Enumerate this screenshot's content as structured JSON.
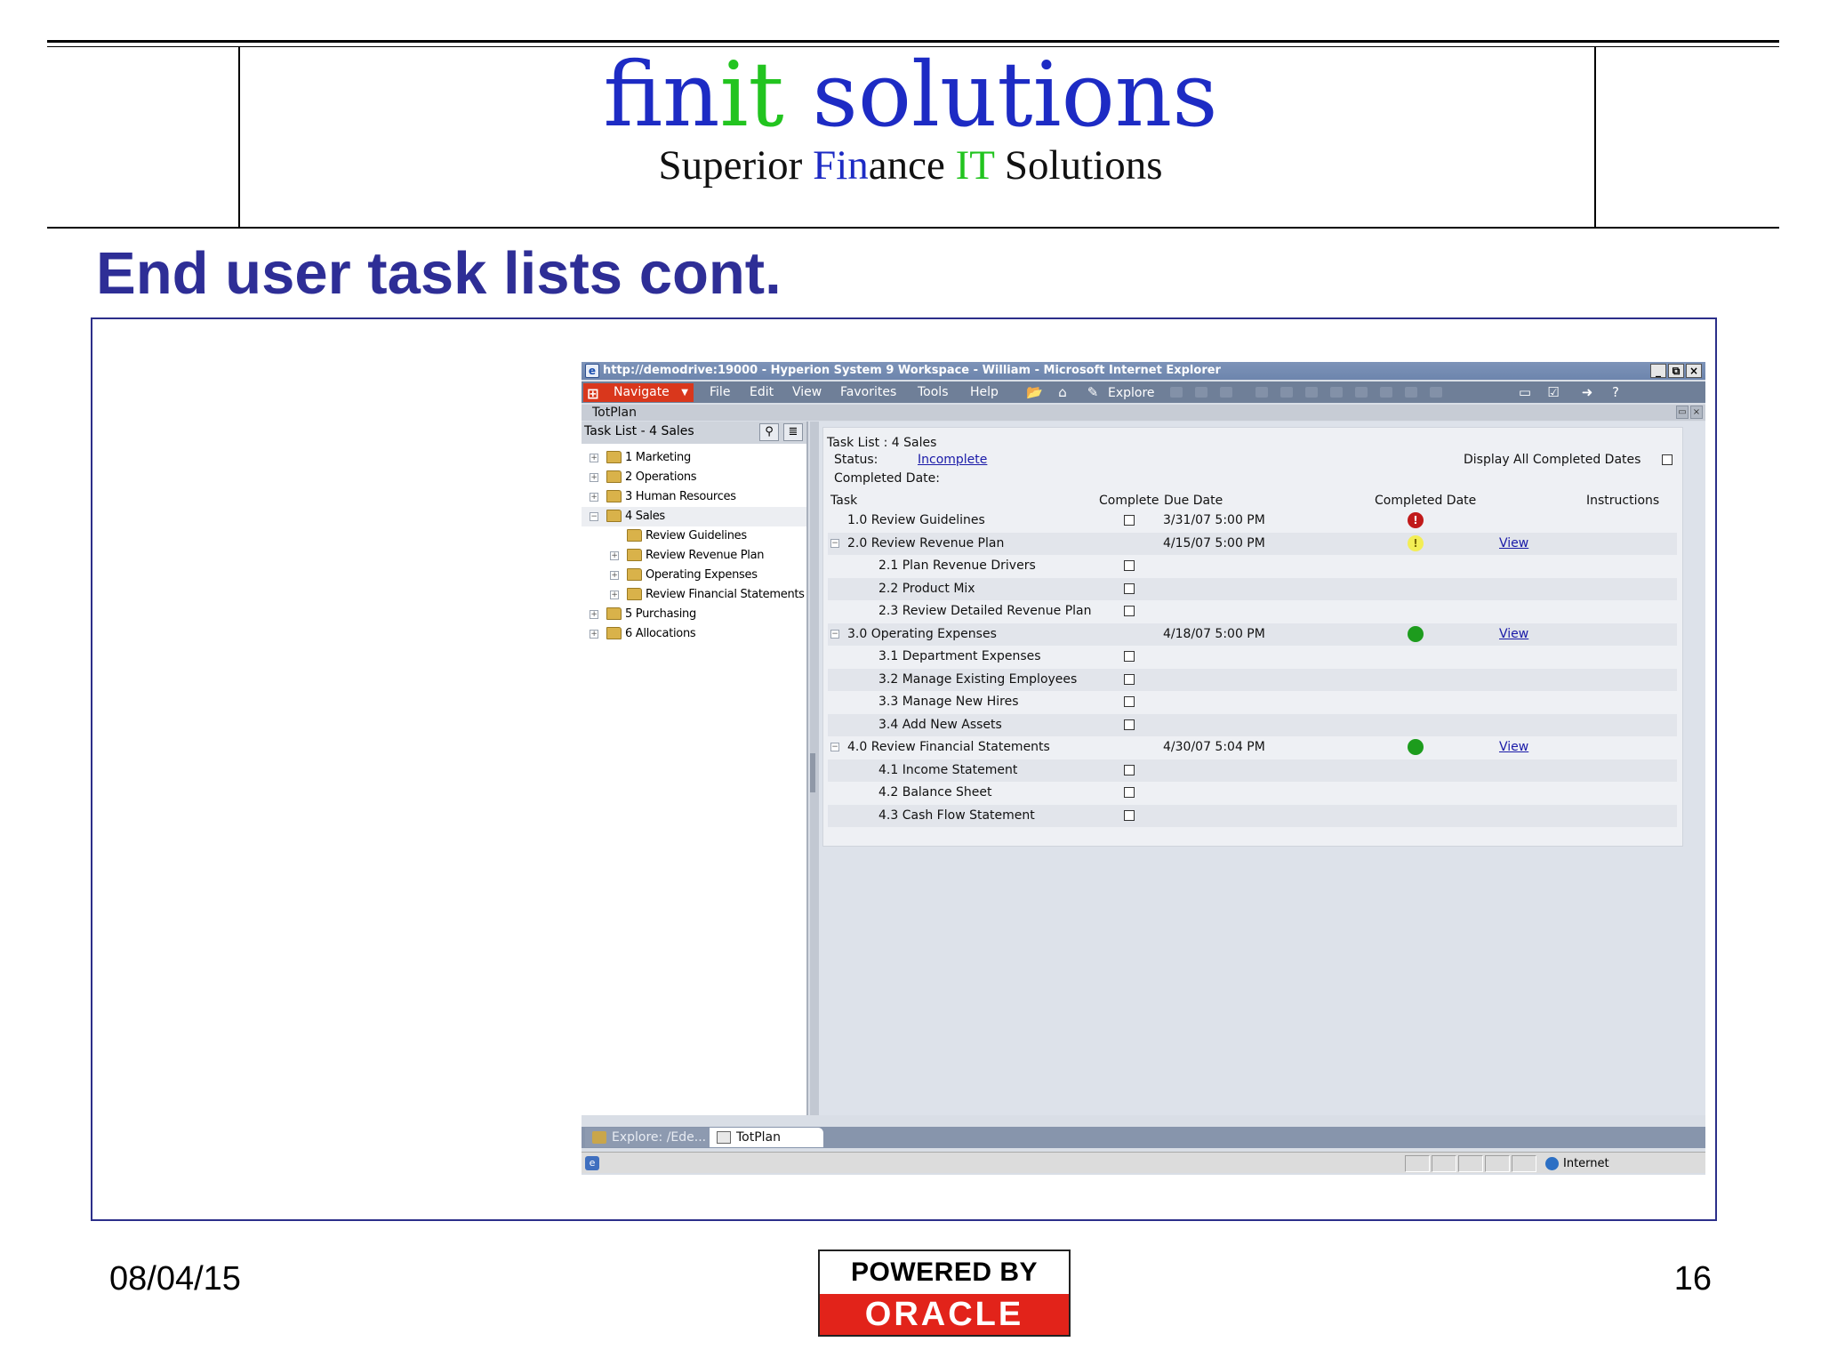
{
  "slide": {
    "logo": {
      "part1": "fin",
      "part2": "it",
      "part3": " solutions"
    },
    "tagline": {
      "t1": "Superior ",
      "t2": "Fin",
      "t3": "ance ",
      "t4": "IT",
      "t5": " Solutions"
    },
    "title": "End user task lists cont.",
    "date": "08/04/15",
    "page_number": "16",
    "badge": {
      "top": "POWERED BY",
      "bottom": "ORACLE"
    }
  },
  "window": {
    "title": "http://demodrive:19000 - Hyperion System 9 Workspace - William - Microsoft Internet Explorer",
    "buttons": {
      "minimize": "_",
      "restore": "⧉",
      "close": "×"
    }
  },
  "menubar": {
    "navigate": "Navigate",
    "items": [
      "File",
      "Edit",
      "View",
      "Favorites",
      "Tools",
      "Help"
    ],
    "explore": "Explore"
  },
  "doc_title": "TotPlan",
  "left_pane": {
    "header": "Task List - 4 Sales",
    "tree": [
      {
        "label": "1 Marketing",
        "expander": "+"
      },
      {
        "label": "2 Operations",
        "expander": "+"
      },
      {
        "label": "3 Human Resources",
        "expander": "+"
      },
      {
        "label": "4 Sales",
        "expander": "−"
      },
      {
        "label": "Review Guidelines",
        "expander": ""
      },
      {
        "label": "Review Revenue Plan",
        "expander": "+"
      },
      {
        "label": "Operating Expenses",
        "expander": "+"
      },
      {
        "label": "Review Financial Statements",
        "expander": "+"
      },
      {
        "label": "5 Purchasing",
        "expander": "+"
      },
      {
        "label": "6 Allocations",
        "expander": "+"
      }
    ]
  },
  "task_panel": {
    "heading": "Task List : 4 Sales",
    "status_label": "Status:",
    "status_value": "Incomplete",
    "completed_date_label": "Completed Date:",
    "display_all_label": "Display All Completed Dates",
    "columns": {
      "task": "Task",
      "complete": "Complete",
      "due_date": "Due Date",
      "completed_date": "Completed Date",
      "instructions": "Instructions"
    },
    "rows": [
      {
        "task": "1.0 Review Guidelines",
        "due": "3/31/07 5:00 PM",
        "status": "red",
        "view": ""
      },
      {
        "task": "2.0 Review Revenue Plan",
        "due": "4/15/07 5:00 PM",
        "status": "yellow",
        "view": "View"
      },
      {
        "task": "2.1 Plan Revenue Drivers",
        "due": "",
        "status": "",
        "view": ""
      },
      {
        "task": "2.2 Product Mix",
        "due": "",
        "status": "",
        "view": ""
      },
      {
        "task": "2.3 Review Detailed Revenue Plan",
        "due": "",
        "status": "",
        "view": ""
      },
      {
        "task": "3.0 Operating Expenses",
        "due": "4/18/07 5:00 PM",
        "status": "green",
        "view": "View"
      },
      {
        "task": "3.1 Department Expenses",
        "due": "",
        "status": "",
        "view": ""
      },
      {
        "task": "3.2 Manage Existing Employees",
        "due": "",
        "status": "",
        "view": ""
      },
      {
        "task": "3.3 Manage New Hires",
        "due": "",
        "status": "",
        "view": ""
      },
      {
        "task": "3.4 Add New Assets",
        "due": "",
        "status": "",
        "view": ""
      },
      {
        "task": "4.0 Review Financial Statements",
        "due": "4/30/07 5:04 PM",
        "status": "green",
        "view": "View"
      },
      {
        "task": "4.1 Income Statement",
        "due": "",
        "status": "",
        "view": ""
      },
      {
        "task": "4.2 Balance Sheet",
        "due": "",
        "status": "",
        "view": ""
      },
      {
        "task": "4.3 Cash Flow Statement",
        "due": "",
        "status": "",
        "view": ""
      }
    ]
  },
  "tabs": {
    "tab1": "Explore: /Ede...",
    "tab2": "TotPlan"
  },
  "statusbar": {
    "zone": "Internet"
  },
  "colors": {
    "title_blue": "#2e2e96",
    "logo_blue": "#1d2bc4",
    "logo_green": "#22c41f",
    "navigate_red": "#d9371c",
    "oracle_red": "#e2231a"
  }
}
